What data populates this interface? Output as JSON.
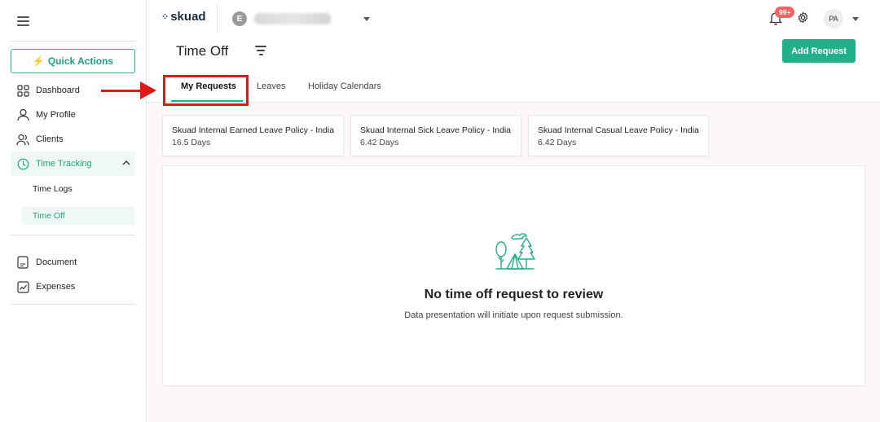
{
  "header": {
    "logo_text": "skuad",
    "company_initial": "E",
    "notification_count": "99+",
    "avatar_initials": "PA"
  },
  "sidebar": {
    "quick_actions_label": "Quick Actions",
    "items": [
      {
        "label": "Dashboard",
        "icon": "grid-icon"
      },
      {
        "label": "My Profile",
        "icon": "user-icon"
      },
      {
        "label": "Clients",
        "icon": "users-icon"
      },
      {
        "label": "Time Tracking",
        "icon": "clock-icon"
      },
      {
        "label": "Document",
        "icon": "document-icon"
      },
      {
        "label": "Expenses",
        "icon": "chart-line-icon"
      }
    ],
    "sub_items": [
      {
        "label": "Time Logs"
      },
      {
        "label": "Time Off"
      }
    ]
  },
  "page": {
    "title": "Time Off",
    "add_button_label": "Add Request"
  },
  "tabs": [
    {
      "label": "My Requests",
      "active": true
    },
    {
      "label": "Leaves",
      "active": false
    },
    {
      "label": "Holiday Calendars",
      "active": false
    }
  ],
  "policies": [
    {
      "name": "Skuad Internal Earned Leave Policy - India",
      "days": "16.5 Days"
    },
    {
      "name": "Skuad Internal Sick Leave Policy - India",
      "days": "6.42 Days"
    },
    {
      "name": "Skuad Internal Casual Leave Policy - India",
      "days": "6.42 Days"
    }
  ],
  "empty_state": {
    "title": "No time off request to review",
    "subtitle": "Data presentation will initiate upon request submission."
  },
  "colors": {
    "accent": "#21b08a",
    "annotation_red": "#e01818",
    "badge_red": "#f06464"
  }
}
